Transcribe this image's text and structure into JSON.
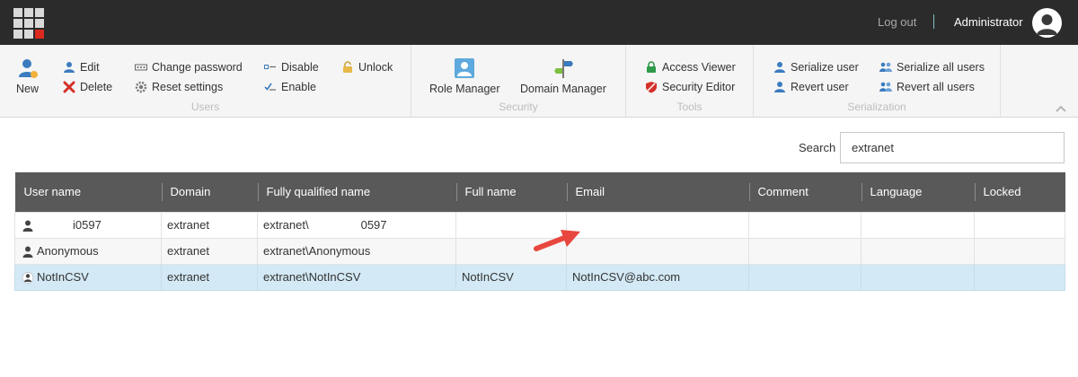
{
  "topbar": {
    "logout_label": "Log out",
    "user_label": "Administrator"
  },
  "ribbon": {
    "users": {
      "title": "Users",
      "new_label": "New",
      "edit_label": "Edit",
      "delete_label": "Delete",
      "change_password_label": "Change password",
      "reset_settings_label": "Reset settings",
      "disable_label": "Disable",
      "enable_label": "Enable",
      "unlock_label": "Unlock"
    },
    "security": {
      "title": "Security",
      "role_manager_label": "Role Manager",
      "domain_manager_label": "Domain Manager"
    },
    "tools": {
      "title": "Tools",
      "access_viewer_label": "Access Viewer",
      "security_editor_label": "Security Editor"
    },
    "serialization": {
      "title": "Serialization",
      "serialize_user_label": "Serialize user",
      "revert_user_label": "Revert user",
      "serialize_all_label": "Serialize all users",
      "revert_all_label": "Revert all users"
    }
  },
  "search": {
    "label": "Search",
    "value": "extranet"
  },
  "table": {
    "columns": [
      "User name",
      "Domain",
      "Fully qualified name",
      "Full name",
      "Email",
      "Comment",
      "Language",
      "Locked"
    ],
    "rows": [
      {
        "user_name_prefix": "",
        "user_name": "i0597",
        "domain": "extranet",
        "fqn_prefix": "extranet\\",
        "fqn_suffix": "0597",
        "full_name": "",
        "email": "",
        "comment": "",
        "language": "",
        "locked": ""
      },
      {
        "user_name_prefix": "",
        "user_name": "Anonymous",
        "domain": "extranet",
        "fqn_prefix": "extranet\\Anonymous",
        "fqn_suffix": "",
        "full_name": "",
        "email": "",
        "comment": "",
        "language": "",
        "locked": ""
      },
      {
        "user_name_prefix": "",
        "user_name": "NotInCSV",
        "domain": "extranet",
        "fqn_prefix": "extranet\\NotInCSV",
        "fqn_suffix": "",
        "full_name": "NotInCSV",
        "email": "NotInCSV@abc.com",
        "comment": "",
        "language": "",
        "locked": ""
      }
    ]
  },
  "colors": {
    "topbar": "#2b2b2b",
    "header": "#595959",
    "selected_row": "#d3e9f5",
    "accent_red": "#dc291e",
    "arrow": "#e8473f"
  }
}
